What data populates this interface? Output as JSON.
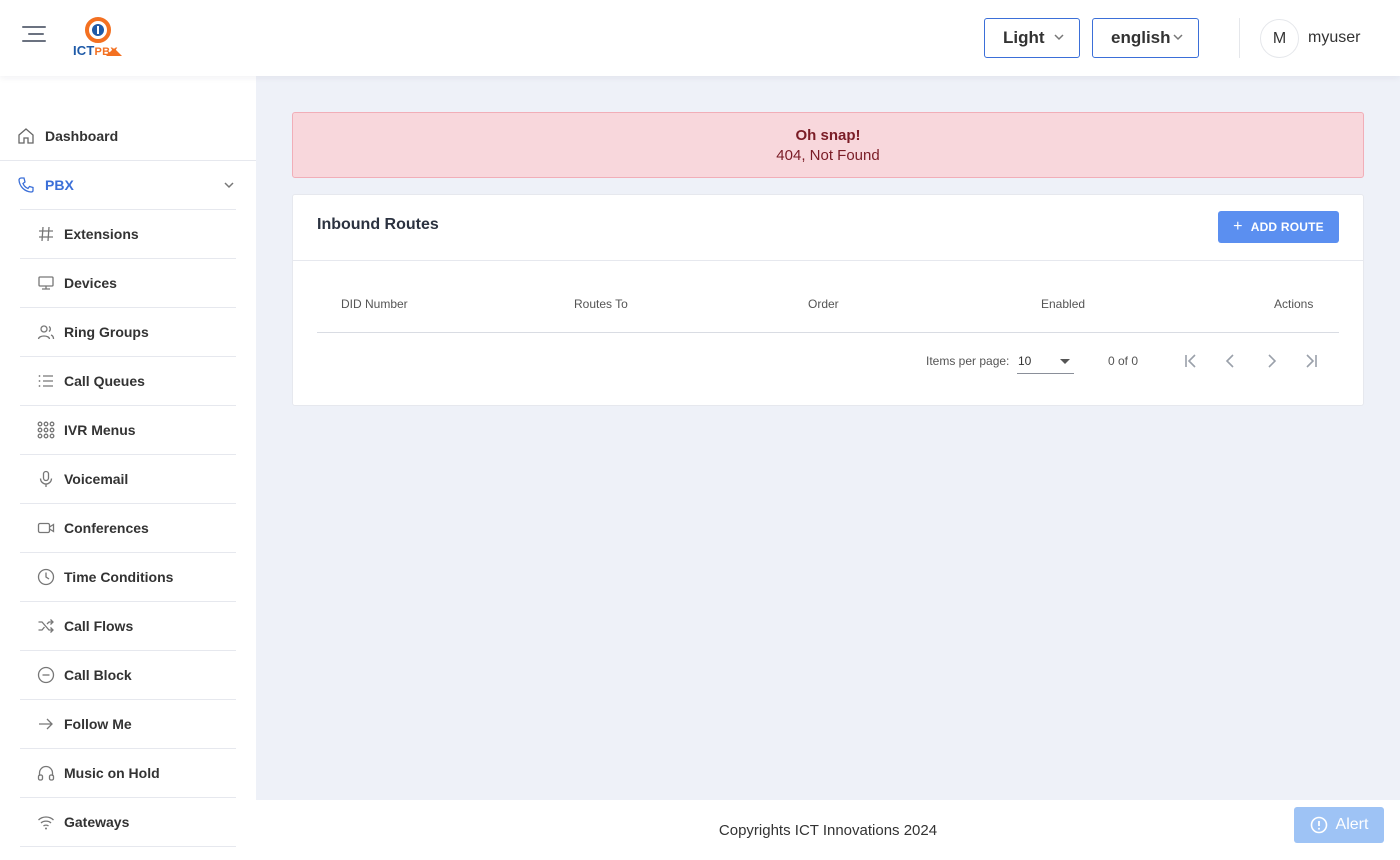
{
  "header": {
    "logo_text_main": "ICT",
    "logo_text_accent": "PBX",
    "theme_select": "Light",
    "language_select": "english",
    "avatar_initial": "M",
    "username": "myuser"
  },
  "sidebar": {
    "dashboard": {
      "label": "Dashboard",
      "icon": "home-icon"
    },
    "pbx": {
      "label": "PBX",
      "icon": "phone-icon",
      "expanded": true
    },
    "pbx_items": [
      {
        "label": "Extensions",
        "icon": "hash-icon"
      },
      {
        "label": "Devices",
        "icon": "monitor-icon"
      },
      {
        "label": "Ring Groups",
        "icon": "users-icon"
      },
      {
        "label": "Call Queues",
        "icon": "list-icon"
      },
      {
        "label": "IVR Menus",
        "icon": "dial-pad-icon"
      },
      {
        "label": "Voicemail",
        "icon": "microphone-icon"
      },
      {
        "label": "Conferences",
        "icon": "video-icon"
      },
      {
        "label": "Time Conditions",
        "icon": "clock-icon"
      },
      {
        "label": "Call Flows",
        "icon": "shuffle-icon"
      },
      {
        "label": "Call Block",
        "icon": "minus-circle-icon"
      },
      {
        "label": "Follow Me",
        "icon": "arrow-right-icon"
      },
      {
        "label": "Music on Hold",
        "icon": "headphones-icon"
      },
      {
        "label": "Gateways",
        "icon": "wifi-icon"
      }
    ]
  },
  "alert": {
    "title": "Oh snap!",
    "message": "404, Not Found"
  },
  "card": {
    "title": "Inbound Routes",
    "add_button": "ADD ROUTE",
    "columns": [
      "DID Number",
      "Routes To",
      "Order",
      "Enabled",
      "Actions"
    ],
    "rows": [],
    "paginator": {
      "items_per_page_label": "Items per page:",
      "items_per_page": "10",
      "range": "0 of 0"
    }
  },
  "footer": {
    "copyright": "Copyrights ICT Innovations 2024",
    "alert_button": "Alert"
  },
  "colors": {
    "accent": "#3b6fd8",
    "button": "#5b8ff0",
    "alert_bg": "#f8d7dc",
    "alert_text": "#7a1c26",
    "page_bg": "#eef1f8"
  }
}
